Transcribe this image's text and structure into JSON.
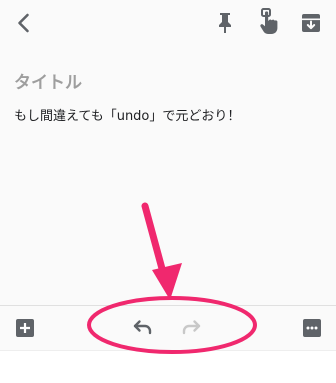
{
  "note": {
    "title": "タイトル",
    "body": "もし間違えても「undo」で元どおり！"
  },
  "icons": {
    "back": "back-arrow-icon",
    "pin": "pin-icon",
    "reminder": "reminder-hand-icon",
    "archive": "archive-icon",
    "add": "add-box-icon",
    "undo": "undo-icon",
    "redo": "redo-icon",
    "more": "more-options-icon"
  },
  "colors": {
    "icon_dark": "#5f6368",
    "icon_disabled": "#c8c8c8",
    "title_gray": "#9e9e9e",
    "annotation_pink": "#f0286e"
  }
}
